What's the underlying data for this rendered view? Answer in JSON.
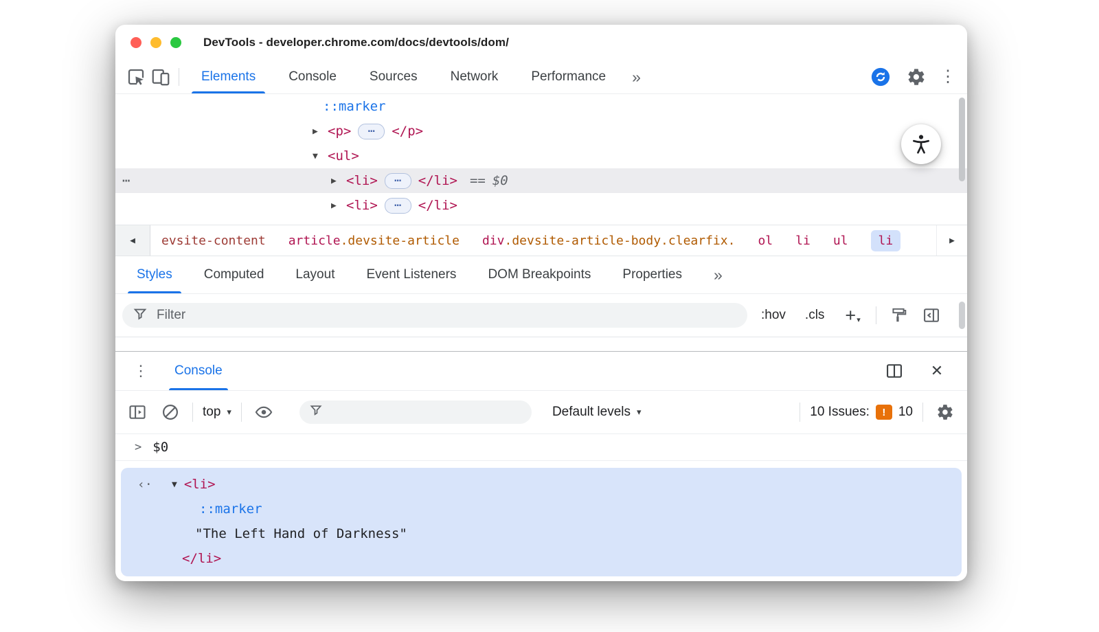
{
  "window": {
    "title": "DevTools - developer.chrome.com/docs/devtools/dom/"
  },
  "glyphs": {
    "collapsed_arrow": "▶",
    "expanded_arrow": "▼",
    "inline_dots": "⋯",
    "gutter_dots": "⋯",
    "overflow_chevron": "»",
    "caret_down": "▾",
    "scroll_left": "◀",
    "scroll_right": "▶",
    "kebab": "⋮",
    "close": "✕",
    "plus": "+",
    "prompt_chevron": ">",
    "result_arrow": "‹·",
    "equals": "=="
  },
  "main_tabs": {
    "active": "Elements",
    "items": [
      {
        "label": "Elements"
      },
      {
        "label": "Console"
      },
      {
        "label": "Sources"
      },
      {
        "label": "Network"
      },
      {
        "label": "Performance"
      }
    ]
  },
  "dom_tree": {
    "rows": [
      {
        "pseudo": "::marker"
      },
      {
        "open": "<p>",
        "close": "</p>"
      },
      {
        "open": "<ul>"
      },
      {
        "open": "<li>",
        "close": "</li>",
        "equals": "==",
        "variable": "$0",
        "selected": true
      },
      {
        "open": "<li>",
        "close": "</li>"
      }
    ]
  },
  "breadcrumbs": {
    "items": [
      {
        "tag": "",
        "classes": "evsite-content"
      },
      {
        "tag": "article",
        "classes": ".devsite-article"
      },
      {
        "tag": "div",
        "classes": ".devsite-article-body.clearfix."
      },
      {
        "tag": "ol",
        "classes": ""
      },
      {
        "tag": "li",
        "classes": ""
      },
      {
        "tag": "ul",
        "classes": ""
      },
      {
        "tag": "li",
        "classes": "",
        "selected": true
      }
    ]
  },
  "styles_tabs": {
    "active": "Styles",
    "items": [
      {
        "label": "Styles"
      },
      {
        "label": "Computed"
      },
      {
        "label": "Layout"
      },
      {
        "label": "Event Listeners"
      },
      {
        "label": "DOM Breakpoints"
      },
      {
        "label": "Properties"
      }
    ]
  },
  "styles_toolbar": {
    "filter_placeholder": "Filter",
    "hov_label": ":hov",
    "cls_label": ".cls"
  },
  "drawer": {
    "tab": "Console"
  },
  "console_toolbar": {
    "context": "top",
    "levels": "Default levels",
    "filter_placeholder": "",
    "issues_text": "10 Issues:",
    "issues_icon": "!",
    "issues_count": "10"
  },
  "console": {
    "command": "$0",
    "result": {
      "open": "<li>",
      "marker": "::marker",
      "text": "\"The Left Hand of Darkness\"",
      "close": "</li>"
    }
  },
  "colors": {
    "accent_blue": "#1a73e8",
    "tag_crimson": "#b01552",
    "class_orange": "#b05a00",
    "crumb_maroon": "#9d3b35",
    "pseudo_blue": "#1a73e8",
    "issues_orange": "#e8710a",
    "result_highlight": "#d8e4fa",
    "selected_row_gray": "#ececef",
    "traffic_red": "#ff5f57",
    "traffic_yellow": "#febc2e",
    "traffic_green": "#2ac840"
  }
}
